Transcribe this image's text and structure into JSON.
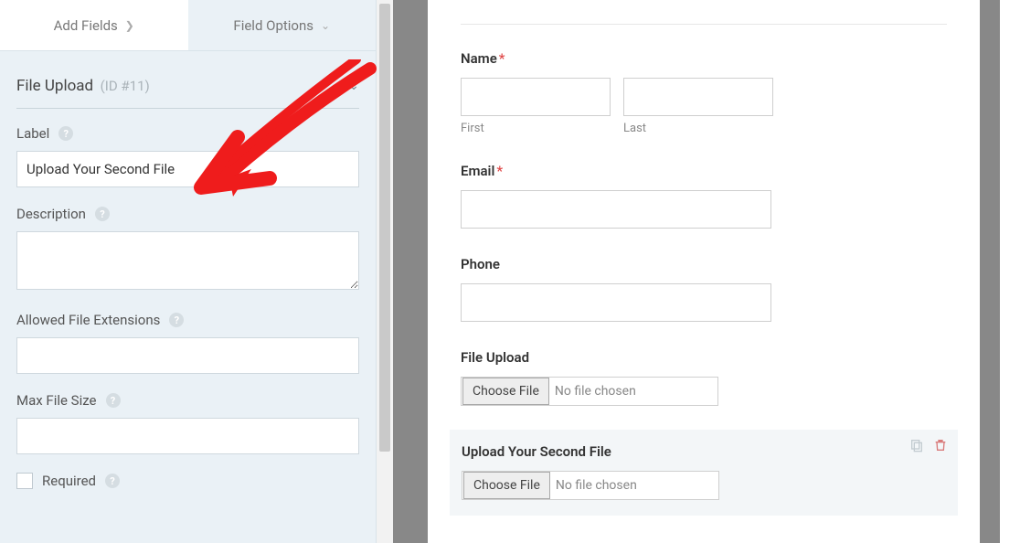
{
  "tabs": {
    "add_fields": "Add Fields",
    "field_options": "Field Options"
  },
  "section": {
    "title": "File Upload",
    "id": "(ID #11)"
  },
  "options": {
    "label_label": "Label",
    "label_value": "Upload Your Second File",
    "description_label": "Description",
    "description_value": "",
    "extensions_label": "Allowed File Extensions",
    "extensions_value": "",
    "maxsize_label": "Max File Size",
    "maxsize_value": "",
    "required_label": "Required"
  },
  "preview": {
    "name_label": "Name",
    "first_sub": "First",
    "last_sub": "Last",
    "email_label": "Email",
    "phone_label": "Phone",
    "upload1_label": "File Upload",
    "choose_file": "Choose File",
    "no_file": "No file chosen",
    "upload2_label": "Upload Your Second File"
  }
}
